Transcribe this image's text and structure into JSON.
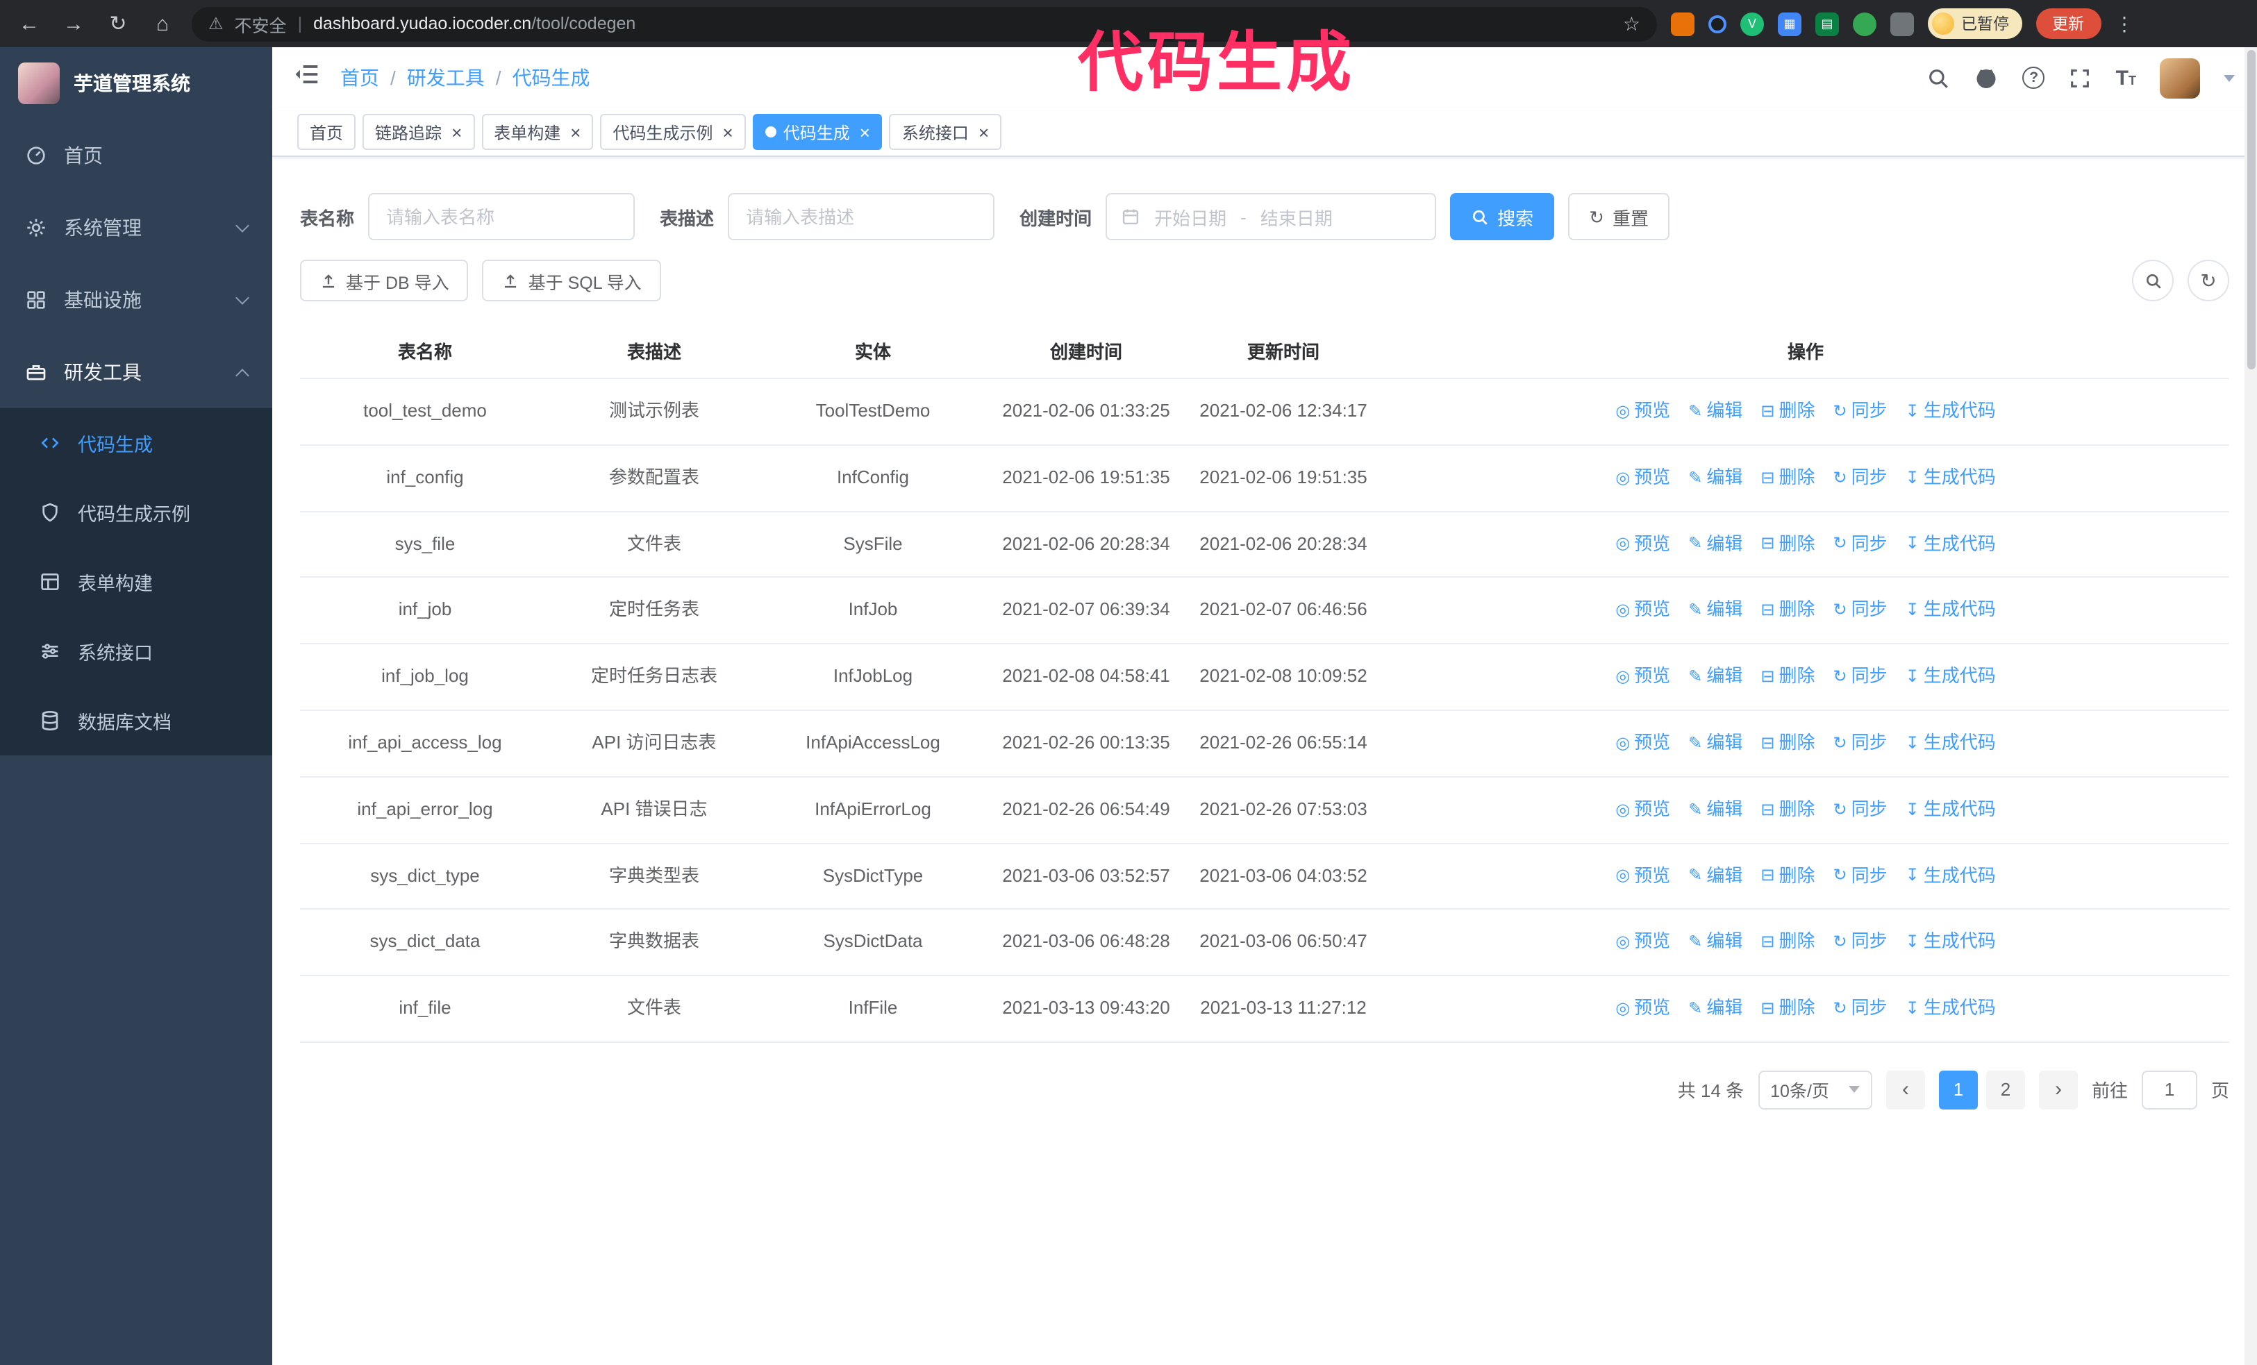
{
  "browser": {
    "security_label": "不安全",
    "url_host": "dashboard.yudao.iocoder.cn",
    "url_path": "/tool/codegen",
    "profile_badge": "已暂停",
    "update_button": "更新"
  },
  "annotation": {
    "text": "代码生成",
    "color": "#ff2e63"
  },
  "sidebar": {
    "logo_title": "芋道管理系统",
    "items": [
      {
        "label": "首页",
        "icon": "dashboard-icon"
      },
      {
        "label": "系统管理",
        "icon": "gear-icon",
        "expandable": true
      },
      {
        "label": "基础设施",
        "icon": "infrastructure-icon",
        "expandable": true
      },
      {
        "label": "研发工具",
        "icon": "tools-icon",
        "expandable": true,
        "expanded": true
      }
    ],
    "submenu": [
      {
        "label": "代码生成",
        "icon": "code-icon",
        "active": true
      },
      {
        "label": "代码生成示例",
        "icon": "example-icon"
      },
      {
        "label": "表单构建",
        "icon": "form-icon"
      },
      {
        "label": "系统接口",
        "icon": "api-icon"
      },
      {
        "label": "数据库文档",
        "icon": "database-icon"
      }
    ]
  },
  "header": {
    "breadcrumb": [
      "首页",
      "研发工具",
      "代码生成"
    ]
  },
  "tabs": [
    {
      "label": "首页",
      "closable": false,
      "active": false
    },
    {
      "label": "链路追踪",
      "closable": true,
      "active": false
    },
    {
      "label": "表单构建",
      "closable": true,
      "active": false
    },
    {
      "label": "代码生成示例",
      "closable": true,
      "active": false
    },
    {
      "label": "代码生成",
      "closable": true,
      "active": true
    },
    {
      "label": "系统接口",
      "closable": true,
      "active": false
    }
  ],
  "filters": {
    "table_name_label": "表名称",
    "table_name_placeholder": "请输入表名称",
    "table_desc_label": "表描述",
    "table_desc_placeholder": "请输入表描述",
    "create_time_label": "创建时间",
    "date_start_placeholder": "开始日期",
    "date_separator": "-",
    "date_end_placeholder": "结束日期",
    "search_button": "搜索",
    "reset_button": "重置"
  },
  "toolbar": {
    "import_db_button": "基于 DB 导入",
    "import_sql_button": "基于 SQL 导入"
  },
  "table": {
    "columns": [
      "表名称",
      "表描述",
      "实体",
      "创建时间",
      "更新时间",
      "操作"
    ],
    "actions": [
      {
        "label": "预览",
        "icon": "eye-icon"
      },
      {
        "label": "编辑",
        "icon": "edit-icon"
      },
      {
        "label": "删除",
        "icon": "delete-icon"
      },
      {
        "label": "同步",
        "icon": "sync-icon"
      },
      {
        "label": "生成代码",
        "icon": "generate-code-icon"
      }
    ],
    "rows": [
      {
        "name": "tool_test_demo",
        "desc": "测试示例表",
        "entity": "ToolTestDemo",
        "created": "2021-02-06 01:33:25",
        "updated": "2021-02-06 12:34:17"
      },
      {
        "name": "inf_config",
        "desc": "参数配置表",
        "entity": "InfConfig",
        "created": "2021-02-06 19:51:35",
        "updated": "2021-02-06 19:51:35"
      },
      {
        "name": "sys_file",
        "desc": "文件表",
        "entity": "SysFile",
        "created": "2021-02-06 20:28:34",
        "updated": "2021-02-06 20:28:34"
      },
      {
        "name": "inf_job",
        "desc": "定时任务表",
        "entity": "InfJob",
        "created": "2021-02-07 06:39:34",
        "updated": "2021-02-07 06:46:56"
      },
      {
        "name": "inf_job_log",
        "desc": "定时任务日志表",
        "entity": "InfJobLog",
        "created": "2021-02-08 04:58:41",
        "updated": "2021-02-08 10:09:52"
      },
      {
        "name": "inf_api_access_log",
        "desc": "API 访问日志表",
        "entity": "InfApiAccessLog",
        "created": "2021-02-26 00:13:35",
        "updated": "2021-02-26 06:55:14"
      },
      {
        "name": "inf_api_error_log",
        "desc": "API 错误日志",
        "entity": "InfApiErrorLog",
        "created": "2021-02-26 06:54:49",
        "updated": "2021-02-26 07:53:03"
      },
      {
        "name": "sys_dict_type",
        "desc": "字典类型表",
        "entity": "SysDictType",
        "created": "2021-03-06 03:52:57",
        "updated": "2021-03-06 04:03:52"
      },
      {
        "name": "sys_dict_data",
        "desc": "字典数据表",
        "entity": "SysDictData",
        "created": "2021-03-06 06:48:28",
        "updated": "2021-03-06 06:50:47"
      },
      {
        "name": "inf_file",
        "desc": "文件表",
        "entity": "InfFile",
        "created": "2021-03-13 09:43:20",
        "updated": "2021-03-13 11:27:12"
      }
    ]
  },
  "pagination": {
    "total": "共 14 条",
    "page_size": "10条/页",
    "pages": [
      "1",
      "2"
    ],
    "current": "1",
    "goto_label": "前往",
    "goto_value": "1",
    "page_unit": "页"
  }
}
